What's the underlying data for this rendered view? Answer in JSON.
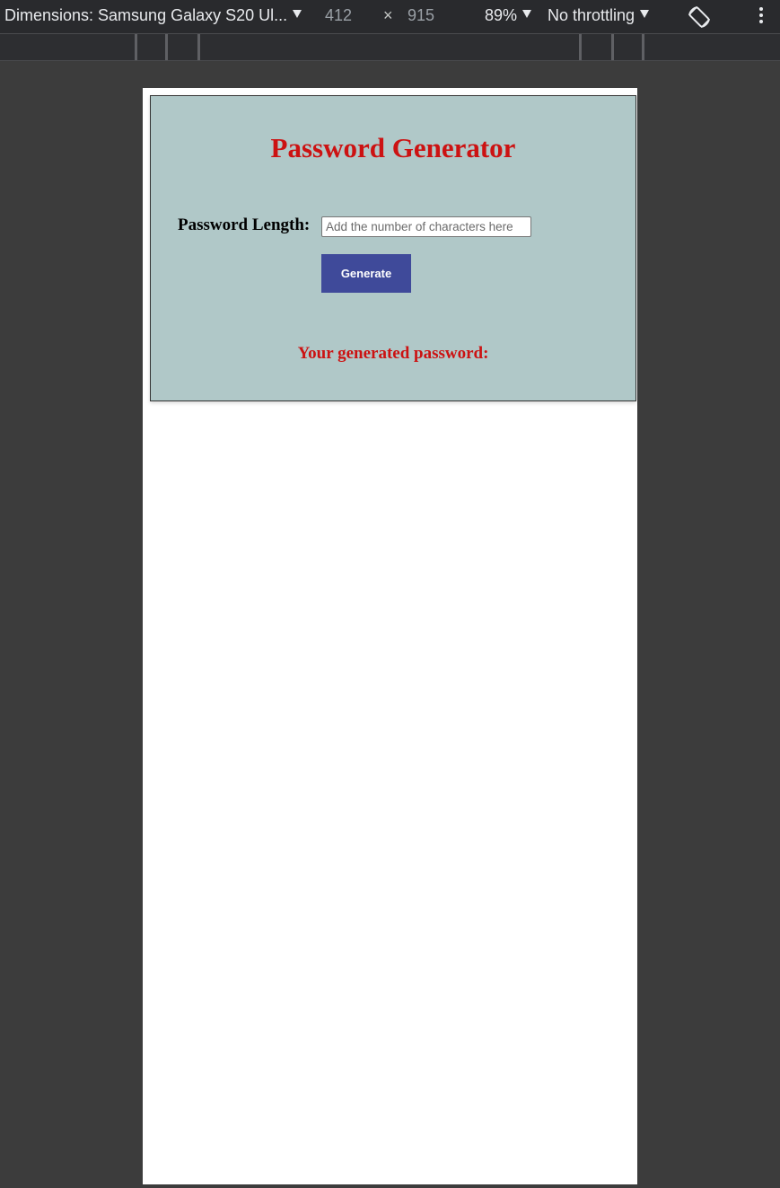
{
  "devtools": {
    "dimensions_label": "Dimensions: Samsung Galaxy S20 Ul...",
    "width": "412",
    "times": "×",
    "height": "915",
    "zoom": "89%",
    "throttling": "No throttling",
    "icons": [
      "rotate-icon",
      "more-options-icon",
      "chevron-down-icon"
    ]
  },
  "page": {
    "title": "Password Generator",
    "length_label": "Password Length:",
    "length_placeholder": "Add the number of characters here",
    "length_value": "",
    "generate_label": "Generate",
    "result_label": "Your generated password:"
  },
  "colors": {
    "card_background": "#b0c8c8",
    "heading_red": "#cc1212",
    "button_blue": "#3f4a9a"
  }
}
